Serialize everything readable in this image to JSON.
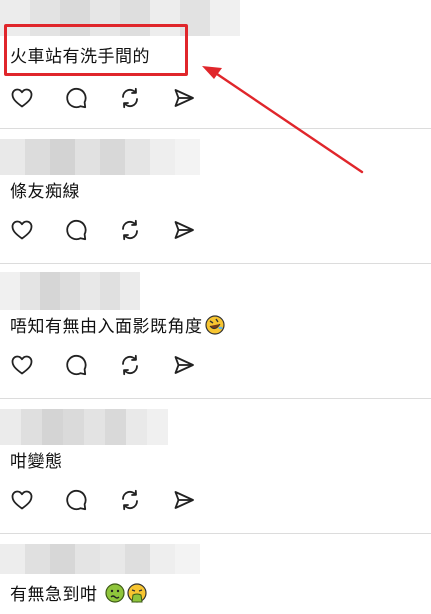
{
  "posts": [
    {
      "text": "火車站有洗手間的",
      "highlighted": true
    },
    {
      "text": "條友痴線"
    },
    {
      "text": "唔知有無由入面影既角度",
      "emoji": [
        "rolling-laughing-emoji"
      ]
    },
    {
      "text": "咁變態"
    },
    {
      "text": "有無急到咁",
      "emoji": [
        "nauseated-emoji",
        "vomiting-emoji"
      ]
    }
  ],
  "actions": [
    "like-icon",
    "comment-icon",
    "repost-icon",
    "share-icon"
  ],
  "annotation": {
    "box_color": "#e0262b",
    "arrow_color": "#e0262b"
  }
}
